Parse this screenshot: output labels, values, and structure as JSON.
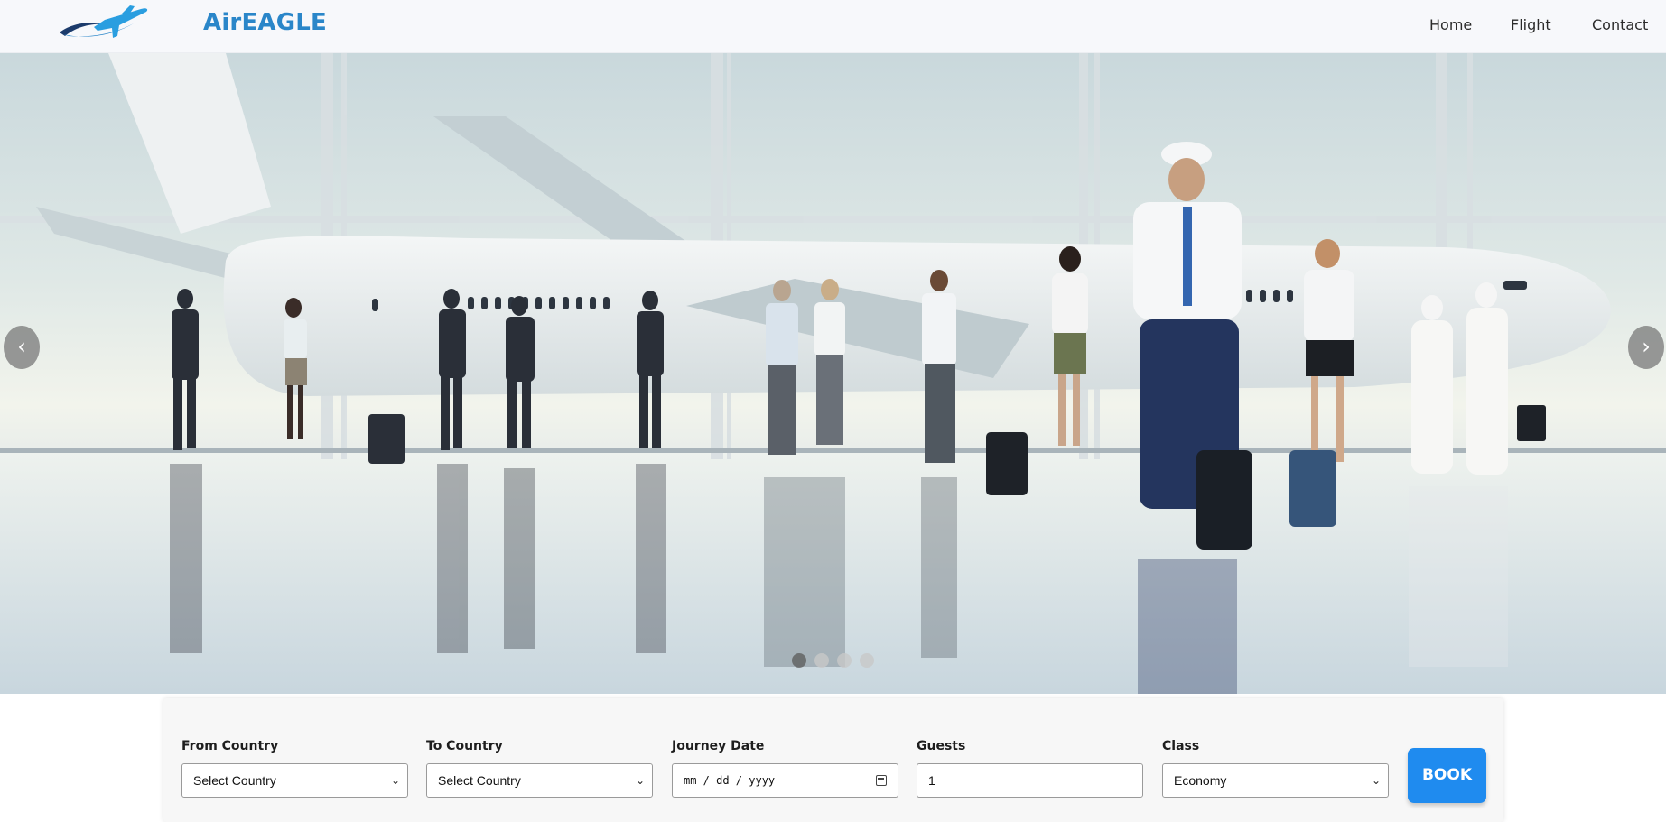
{
  "brand": {
    "name": "AirEAGLE",
    "logo_icon": "airplane-swoosh-icon",
    "colors": {
      "brand_blue": "#2a86c9",
      "logo_dark": "#1c3b6b"
    }
  },
  "nav": {
    "items": [
      {
        "label": "Home"
      },
      {
        "label": "Flight"
      },
      {
        "label": "Contact"
      }
    ]
  },
  "hero": {
    "image": "airport-terminal-travelers-photo",
    "prev_icon": "‹",
    "next_icon": "›",
    "slides_count": 4,
    "active_slide": 1
  },
  "booking": {
    "from": {
      "label": "From Country",
      "value": "Select Country"
    },
    "to": {
      "label": "To Country",
      "value": "Select Country"
    },
    "date": {
      "label": "Journey Date",
      "value": "mm / dd / yyyy"
    },
    "guests": {
      "label": "Guests",
      "value": "1"
    },
    "class": {
      "label": "Class",
      "value": "Economy"
    },
    "book_label": "BOOK",
    "colors": {
      "button": "#1f8bef"
    }
  }
}
